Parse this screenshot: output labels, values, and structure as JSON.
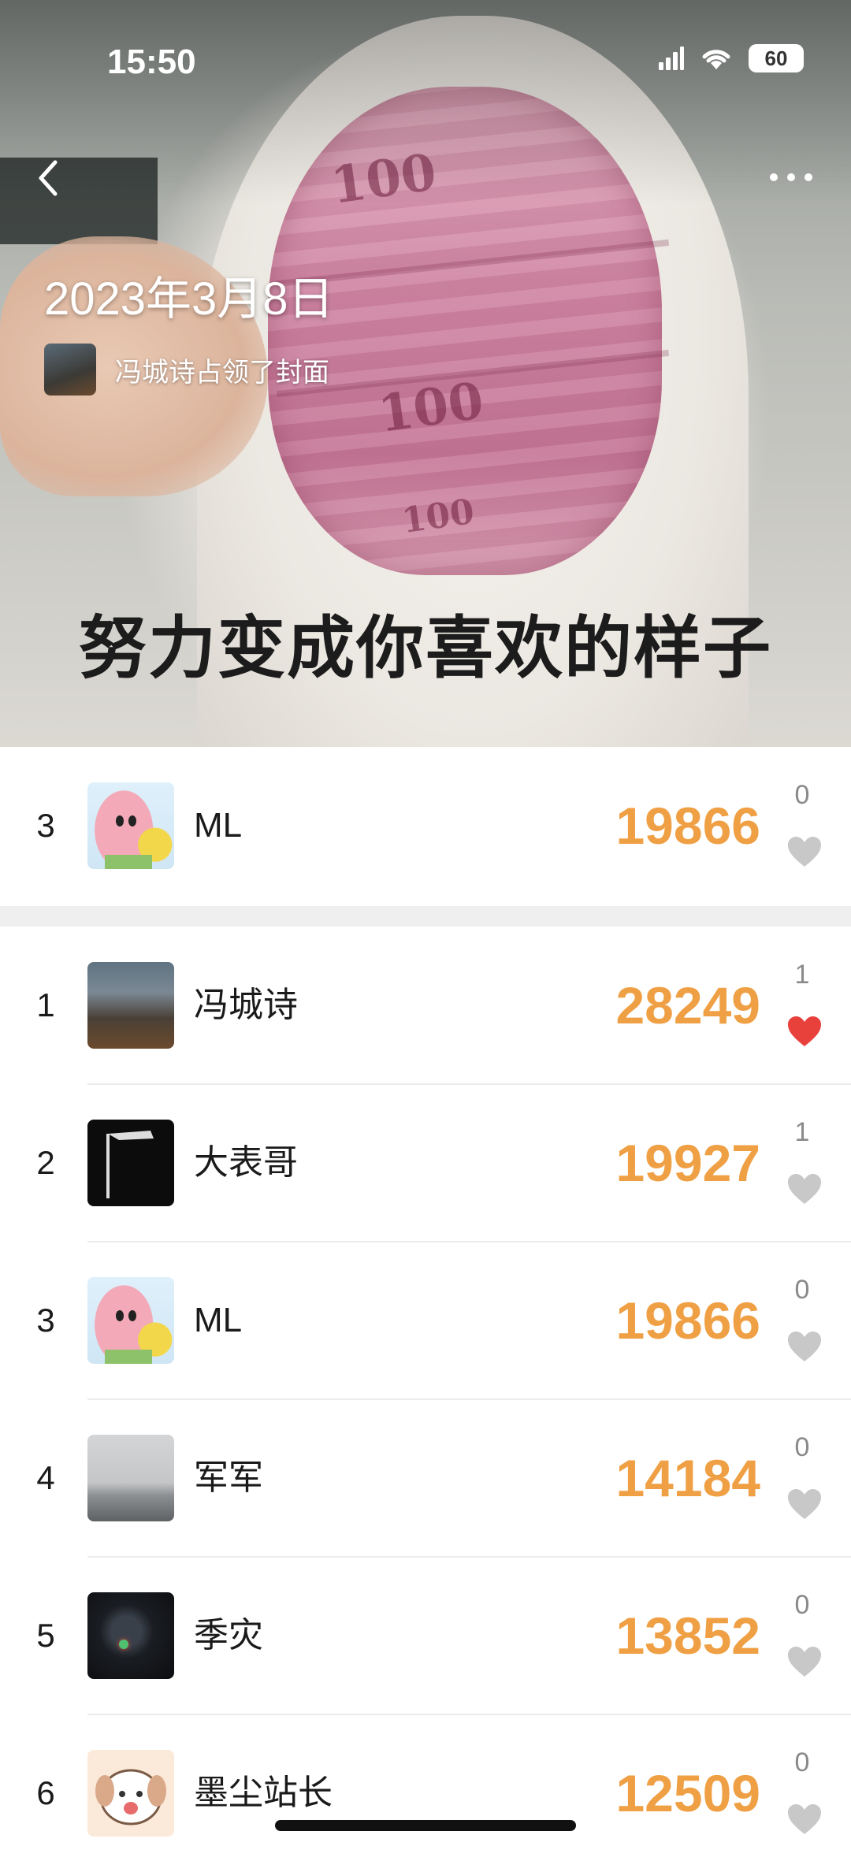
{
  "status_bar": {
    "time": "15:50",
    "battery": "60"
  },
  "cover": {
    "date": "2023年3月8日",
    "owner_text": "冯城诗占领了封面",
    "caption": "努力变成你喜欢的样子",
    "banknote_text": "100"
  },
  "my_rank": {
    "rank": "3",
    "name": "ML",
    "steps": "19866",
    "likes": "0",
    "liked": false
  },
  "ranking": [
    {
      "rank": "1",
      "name": "冯城诗",
      "steps": "28249",
      "likes": "1",
      "liked": true,
      "avatar": "landscape"
    },
    {
      "rank": "2",
      "name": "大表哥",
      "steps": "19927",
      "likes": "1",
      "liked": false,
      "avatar": "shower"
    },
    {
      "rank": "3",
      "name": "ML",
      "steps": "19866",
      "likes": "0",
      "liked": false,
      "avatar": "patrick"
    },
    {
      "rank": "4",
      "name": "军军",
      "steps": "14184",
      "likes": "0",
      "liked": false,
      "avatar": "road"
    },
    {
      "rank": "5",
      "name": "季灾",
      "steps": "13852",
      "likes": "0",
      "liked": false,
      "avatar": "astronaut"
    },
    {
      "rank": "6",
      "name": "墨尘站长",
      "steps": "12509",
      "likes": "0",
      "liked": false,
      "avatar": "dog"
    }
  ],
  "colors": {
    "steps": "#f0a044",
    "heart_liked": "#e8413c",
    "heart_unliked": "#c8c8c8"
  }
}
